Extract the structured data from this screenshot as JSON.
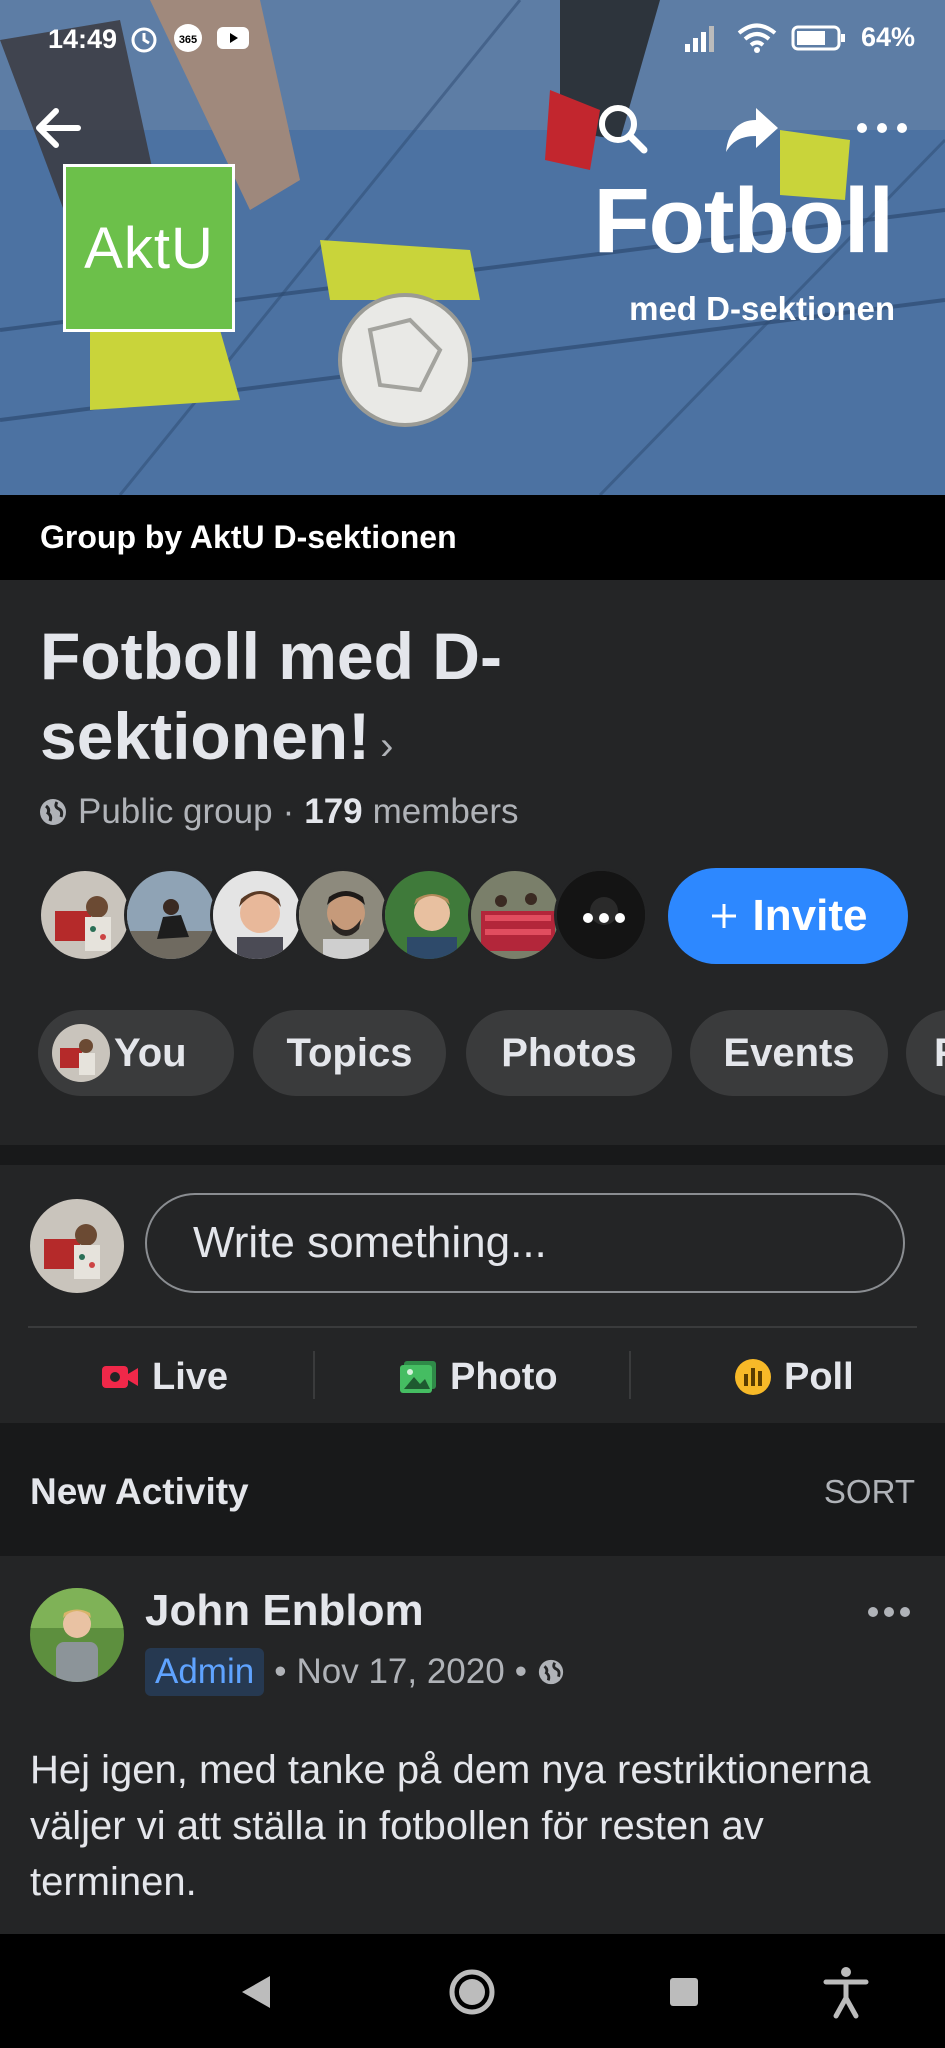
{
  "status_bar": {
    "time": "14:49",
    "battery": "64%"
  },
  "cover": {
    "logo_text": "AktU",
    "title": "Fotboll",
    "subtitle": "med D-sektionen"
  },
  "group_by": "Group by AktU D-sektionen",
  "group": {
    "name": "Fotboll med D-sektionen!",
    "privacy": "Public group",
    "separator": "·",
    "member_count": "179",
    "members_label": "members",
    "invite_label": "Invite"
  },
  "chips": [
    "You",
    "Topics",
    "Photos",
    "Events",
    "F"
  ],
  "composer": {
    "placeholder": "Write something...",
    "actions": [
      "Live",
      "Photo",
      "Poll"
    ]
  },
  "activity": {
    "title": "New Activity",
    "sort_label": "SORT"
  },
  "post": {
    "author": "John Enblom",
    "role": "Admin",
    "date": "Nov 17, 2020",
    "dot": "•",
    "text": "Hej igen, med tanke på dem nya restriktionerna väljer vi att ställa in fotbollen för resten av terminen."
  },
  "colors": {
    "accent": "#2d88ff",
    "logo_green": "#6cc04a",
    "live_red": "#f02849",
    "photo_green": "#45bd62",
    "poll_orange": "#f7b928"
  },
  "icons": [
    "back-arrow-icon",
    "search-icon",
    "share-icon",
    "more-icon",
    "globe-icon",
    "plus-icon",
    "live-video-icon",
    "photo-icon",
    "poll-icon"
  ]
}
